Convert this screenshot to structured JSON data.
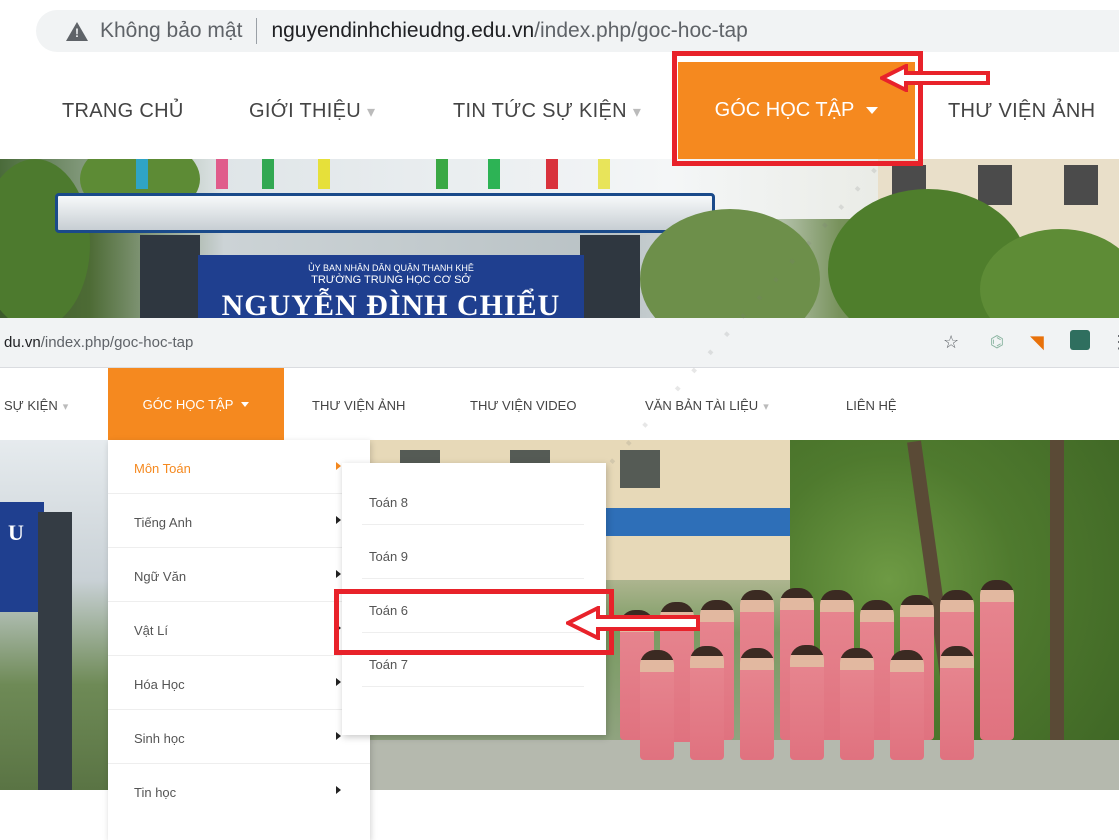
{
  "top": {
    "address_bar": {
      "insecure_label": "Không bảo mật",
      "url_host": "nguyendinhchieudng.edu.vn",
      "url_path": "/index.php/goc-hoc-tap"
    },
    "nav": {
      "home": "TRANG CHỦ",
      "intro": "GIỚI THIỆU",
      "news": "TIN TỨC SỰ KIỆN",
      "study": "GÓC HỌC TẬP",
      "photos": "THƯ VIỆN ẢNH"
    },
    "banner": {
      "line1": "ỦY BAN NHÂN DÂN QUẬN THANH KHÊ",
      "line2": "TRƯỜNG TRUNG HỌC CƠ SỞ",
      "line3": "NGUYỄN ĐÌNH CHIỂU"
    }
  },
  "bottom": {
    "address_bar": {
      "url_host": "du.vn",
      "url_path": "/index.php/goc-hoc-tap"
    },
    "nav": {
      "news_partial": "SỰ KIỆN",
      "study": "GÓC HỌC TẬP",
      "photos": "THƯ VIỆN ẢNH",
      "videos": "THƯ VIỆN VIDEO",
      "documents": "VĂN BẢN TÀI LIỆU",
      "contact": "LIÊN HỆ"
    },
    "gate_letter": "U",
    "subjects_menu": [
      "Môn Toán",
      "Tiếng Anh",
      "Ngữ Văn",
      "Vật Lí",
      "Hóa Học",
      "Sinh học",
      "Tin học"
    ],
    "math_submenu": [
      "Toán 8",
      "Toán 9",
      "Toán 6",
      "Toán 7"
    ]
  },
  "colors": {
    "accent_orange": "#f5891f",
    "highlight_red": "#e8222a"
  },
  "icons": [
    "warning-icon",
    "star-icon",
    "extension-icon",
    "chevron-down-icon",
    "chevron-right-icon",
    "red-arrow-icon"
  ]
}
